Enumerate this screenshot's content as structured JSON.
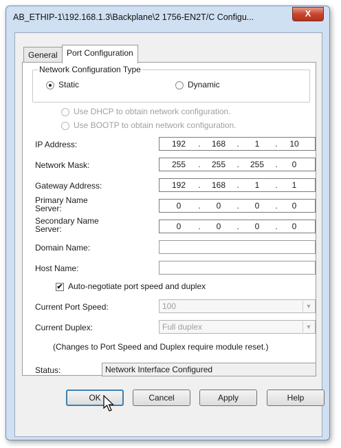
{
  "window": {
    "title": "AB_ETHIP-1\\192.168.1.3\\Backplane\\2 1756-EN2T/C Configu...",
    "close_glyph": "X"
  },
  "tabs": [
    {
      "label": "General",
      "active": false
    },
    {
      "label": "Port Configuration",
      "active": true
    }
  ],
  "network_config_type": {
    "legend": "Network Configuration Type",
    "static_label": "Static",
    "dynamic_label": "Dynamic",
    "selected": "Static"
  },
  "dynamic_options": {
    "dhcp_label": "Use DHCP to obtain network configuration.",
    "bootp_label": "Use BOOTP to obtain network configuration."
  },
  "fields": {
    "ip_address": {
      "label": "IP Address:",
      "octets": [
        "192",
        "168",
        "1",
        "10"
      ]
    },
    "network_mask": {
      "label": "Network Mask:",
      "octets": [
        "255",
        "255",
        "255",
        "0"
      ]
    },
    "gateway_address": {
      "label": "Gateway Address:",
      "octets": [
        "192",
        "168",
        "1",
        "1"
      ]
    },
    "primary_dns": {
      "label_line1": "Primary Name",
      "label_line2": "Server:",
      "octets": [
        "0",
        "0",
        "0",
        "0"
      ]
    },
    "secondary_dns": {
      "label_line1": "Secondary Name",
      "label_line2": "Server:",
      "octets": [
        "0",
        "0",
        "0",
        "0"
      ]
    },
    "domain_name": {
      "label": "Domain Name:",
      "value": ""
    },
    "host_name": {
      "label": "Host Name:",
      "value": ""
    }
  },
  "auto_negotiate": {
    "label": "Auto-negotiate port speed and duplex",
    "checked": true,
    "check_glyph": "✔"
  },
  "port_speed": {
    "label": "Current Port Speed:",
    "value": "100"
  },
  "duplex": {
    "label": "Current Duplex:",
    "value": "Full duplex"
  },
  "note": "(Changes to Port Speed and Duplex require module reset.)",
  "status": {
    "label": "Status:",
    "value": "Network Interface Configured"
  },
  "buttons": {
    "ok": "OK",
    "cancel": "Cancel",
    "apply": "Apply",
    "help": "Help"
  },
  "icons": {
    "dropdown": "chevron-down-icon",
    "cursor": "mouse-pointer-icon"
  }
}
